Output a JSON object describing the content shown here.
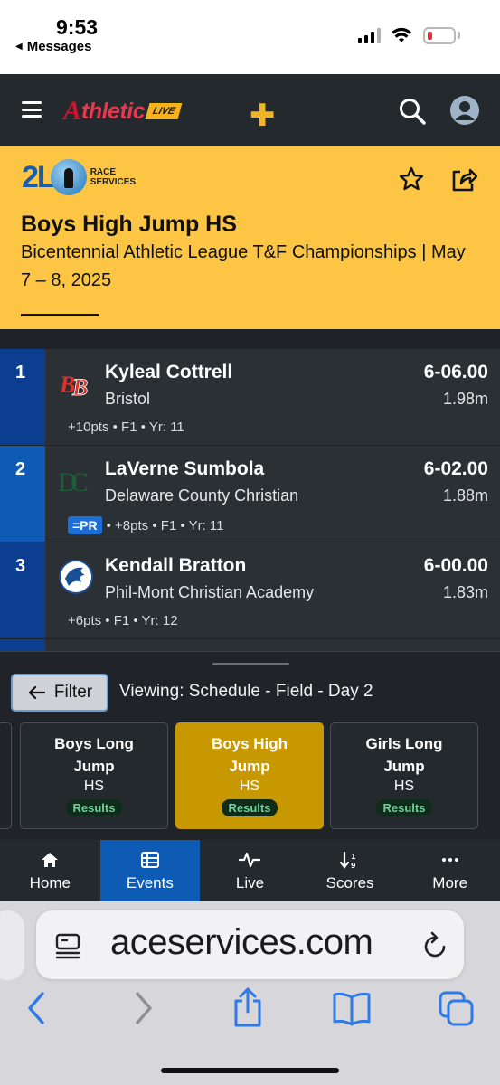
{
  "status_bar": {
    "time": "9:53",
    "back_label": "Messages"
  },
  "app_header": {
    "brand_text": "thletic",
    "brand_badge": "LIVE",
    "brand_initial": "A"
  },
  "event": {
    "provider_logo": {
      "mark": "2L",
      "line1": "RACE",
      "line2": "SERVICES"
    },
    "title": "Boys High Jump HS",
    "meet": "Bicentennial Athletic League T&F Championships | May 7 – 8, 2025"
  },
  "results": [
    {
      "place": "1",
      "athlete": "Kyleal Cottrell",
      "school": "Bristol",
      "mark": "6-06.00",
      "metric": "1.98m",
      "meta": "+10pts • F1 • Yr: 11",
      "pr": "",
      "logo": "bristol-logo"
    },
    {
      "place": "2",
      "athlete": "LaVerne Sumbola",
      "school": "Delaware County Christian",
      "mark": "6-02.00",
      "metric": "1.88m",
      "meta": "• +8pts • F1 • Yr: 11",
      "pr": "=PR",
      "logo": "dc-logo"
    },
    {
      "place": "3",
      "athlete": "Kendall Bratton",
      "school": "Phil-Mont Christian Academy",
      "mark": "6-00.00",
      "metric": "1.83m",
      "meta": "+6pts • F1 • Yr: 12",
      "pr": "",
      "logo": "eagle-logo"
    }
  ],
  "sheet": {
    "filter_label": "Filter",
    "viewing": "Viewing: Schedule - Field - Day 2",
    "chips": [
      {
        "name_line1": "Boys Long",
        "name_line2": "Jump",
        "division": "HS",
        "badge": "Results",
        "active": false
      },
      {
        "name_line1": "Boys High",
        "name_line2": "Jump",
        "division": "HS",
        "badge": "Results",
        "active": true
      },
      {
        "name_line1": "Girls Long",
        "name_line2": "Jump",
        "division": "HS",
        "badge": "Results",
        "active": false
      }
    ]
  },
  "nav": [
    {
      "label": "Home",
      "icon": "home-icon"
    },
    {
      "label": "Events",
      "icon": "events-list-icon",
      "active": true
    },
    {
      "label": "Live",
      "icon": "pulse-icon"
    },
    {
      "label": "Scores",
      "icon": "sort-scores-icon"
    },
    {
      "label": "More",
      "icon": "more-dots-icon"
    }
  ],
  "safari": {
    "url": "aceservices.com"
  },
  "colors": {
    "accent_yellow": "#fcc544",
    "place_blue": "#0b3d91",
    "active_nav_blue": "#0e5bb5",
    "chip_active": "#c89800"
  }
}
